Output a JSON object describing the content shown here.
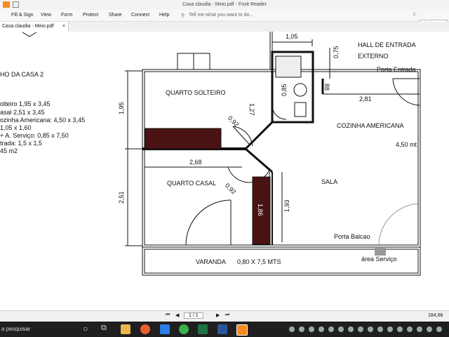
{
  "window": {
    "title": "Casa claudia - Meio.pdf - Foxit Reader"
  },
  "menu": {
    "items": [
      "Fill & Sign",
      "View",
      "Form",
      "Protect",
      "Share",
      "Connect",
      "Help"
    ],
    "tell_me": "Tell me what you want to do...",
    "find_placeholder": "Find"
  },
  "tab": {
    "label": "Casa claudia - Meio.pdf",
    "close": "×"
  },
  "left_list": {
    "heading": "HO DA CASA 2",
    "items": [
      "olteiro 1,95 x 3,45",
      "asal  2,51 x 3,45",
      "ozinha Americana: 4,50 x 3,45",
      " 1,05 x 1,60",
      "+ A. Serviço: 0,85 x 7,50",
      "trada: 1,5 x 1,5",
      " 45 m2"
    ]
  },
  "plan": {
    "rooms": {
      "quarto_solteiro": "QUARTO SOLTEIRO",
      "quarto_casal": "QUARTO CASAL",
      "sala": "SALA",
      "cozinha": "COZINHA AMERICANA",
      "hall_1": "HALL DE ENTRADA",
      "hall_2": "EXTERNO",
      "varanda": "VARANDA",
      "varanda_size": "0,80 X 7,5 MTS",
      "porta_entrada": "Porta Entrada",
      "porta_balcao": "Porta Balcao",
      "area_servico": "área Serviço",
      "largura_cozinha": "4,50 mt"
    },
    "dims": {
      "d105": "1,05",
      "d075": "0,75",
      "d085": "0,85",
      "d127": "1,27",
      "d88": "88",
      "d281": "2,81",
      "d195": "1,95",
      "d092a": "0,92",
      "d268": "2,68",
      "d092b": "0,92",
      "d251": "2,51",
      "d193": "1,93",
      "d186": "1,86"
    }
  },
  "status": {
    "page": "1 / 1",
    "zoom": "184,66"
  },
  "taskbar": {
    "search": "a pesquisar"
  }
}
